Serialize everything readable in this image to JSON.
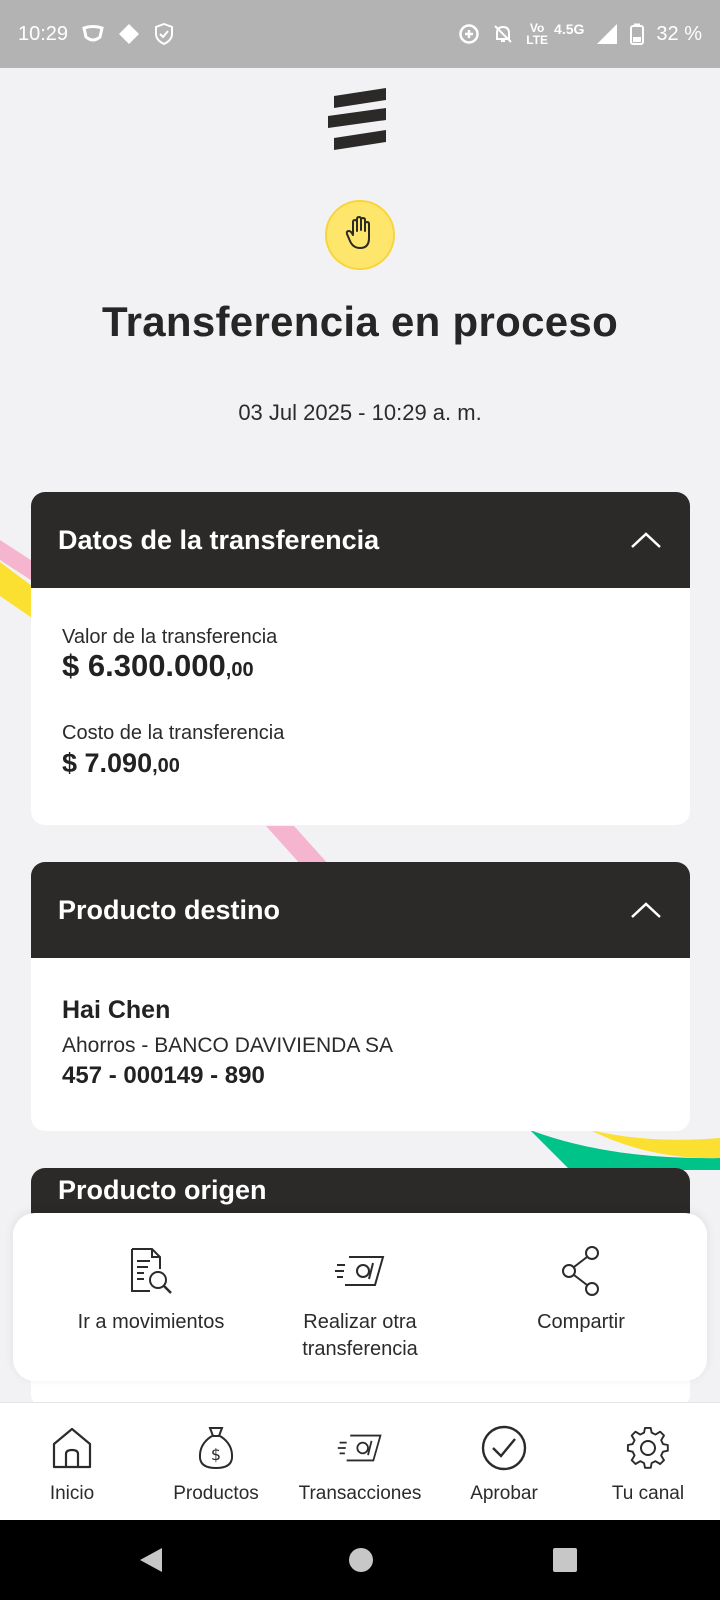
{
  "status_bar": {
    "time": "10:29",
    "network": "4.5G",
    "volte_top": "Vo",
    "volte_bottom": "LTE",
    "battery": "32 %"
  },
  "header": {
    "title": "Transferencia en proceso",
    "timestamp": "03 Jul 2025 - 10:29 a. m."
  },
  "transfer_card": {
    "title": "Datos de la transferencia",
    "value_label": "Valor de la transferencia",
    "value_main": "$ 6.300.000",
    "value_cents": ",00",
    "cost_label": "Costo de la transferencia",
    "cost_main": "$ 7.090",
    "cost_cents": ",00"
  },
  "destination_card": {
    "title": "Producto destino",
    "name": "Hai Chen",
    "account_type": "Ahorros - BANCO DAVIVIENDA SA",
    "account_number": "457 - 000149 - 890"
  },
  "origin_card": {
    "title": "Producto origen"
  },
  "actions": [
    {
      "label": "Ir a movimientos",
      "icon": "document-search-icon"
    },
    {
      "label": "Realizar otra transferencia",
      "icon": "money-transfer-icon"
    },
    {
      "label": "Compartir",
      "icon": "share-icon"
    }
  ],
  "bottom_nav": [
    {
      "label": "Inicio",
      "icon": "home-icon"
    },
    {
      "label": "Productos",
      "icon": "money-bag-icon"
    },
    {
      "label": "Transacciones",
      "icon": "money-transfer-icon"
    },
    {
      "label": "Aprobar",
      "icon": "check-circle-icon"
    },
    {
      "label": "Tu canal",
      "icon": "gear-icon"
    }
  ],
  "colors": {
    "header_dark": "#2b2a29",
    "accent_yellow": "#fde66b",
    "ribbon_pink": "#f5b5cf",
    "ribbon_yellow": "#fbe032",
    "ribbon_green": "#00c389"
  }
}
